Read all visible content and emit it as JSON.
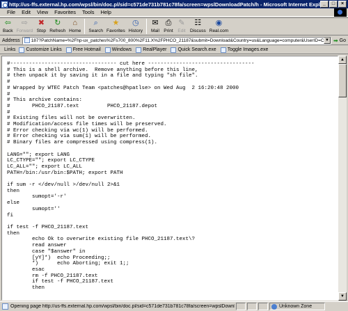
{
  "window": {
    "title": "http://us-ffs.external.hp.com/wpsl/bin/doc.pl/sid=c571de731b781c78fa/screen=wpslDownloadPatch/h - Microsoft Internet Explorer"
  },
  "menu": [
    "File",
    "Edit",
    "View",
    "Favorites",
    "Tools",
    "Help"
  ],
  "toolbar": {
    "buttons": [
      {
        "label": "Back",
        "icon": "back-arrow-icon",
        "glyph": "⇦"
      },
      {
        "label": "Forward",
        "icon": "forward-arrow-icon",
        "glyph": "⇨"
      },
      {
        "label": "Stop",
        "icon": "stop-icon",
        "glyph": "✖"
      },
      {
        "label": "Refresh",
        "icon": "refresh-icon",
        "glyph": "↻"
      },
      {
        "label": "Home",
        "icon": "home-icon",
        "glyph": "⌂"
      },
      {
        "label": "Search",
        "icon": "search-icon",
        "glyph": "⌕"
      },
      {
        "label": "Favorites",
        "icon": "favorites-icon",
        "glyph": "★"
      },
      {
        "label": "History",
        "icon": "history-icon",
        "glyph": "◷"
      },
      {
        "label": "Mail",
        "icon": "mail-icon",
        "glyph": "✉"
      },
      {
        "label": "Print",
        "icon": "print-icon",
        "glyph": "⎙"
      },
      {
        "label": "Edit",
        "icon": "edit-icon",
        "glyph": "✎"
      },
      {
        "label": "Discuss",
        "icon": "discuss-icon",
        "glyph": "☷"
      },
      {
        "label": "Real.com",
        "icon": "realcom-icon",
        "glyph": "◉"
      }
    ]
  },
  "address": {
    "label": "Address",
    "value": "187?PatchName=%2Fhp-ux_patches%2Fs700_800%2F11.X%2FPHCO_21187&submit=Download&Country=us&Language=computer&UserID=CA472732",
    "go_label": "Go"
  },
  "links": {
    "label": "Links",
    "items": [
      "Customize Links",
      "Free Hotmail",
      "Windows",
      "RealPlayer",
      "Quick Search.exe",
      "Toggle Images.exe"
    ]
  },
  "document": {
    "text": "#---------------------------------- cut here ----------------------------------\n# This is a shell archive.  Remove anything before this line,\n# then unpack it by saving it in a file and typing \"sh file\".\n#\n# Wrapped by WTEC Patch Team <patches@hpatlse> on Wed Aug  2 16:20:48 2000\n#\n# This archive contains:\n#       PHCO_21187.text         PHCO_21187.depot\n#\n# Existing files will not be overwritten.\n# Modification/access file times will be preserved.\n# Error checking via wc(1) will be performed.\n# Error checking via sum(1) will be performed.\n# Binary files are compressed using compress(1).\n\nLANG=\"\"; export LANG\nLC_CTYPE=\"\"; export LC_CTYPE\nLC_ALL=\"\"; export LC_ALL\nPATH=/bin:/usr/bin:$PATH; export PATH\n\nif sum -r </dev/null >/dev/null 2>&1\nthen\n        sumopt='-r'\nelse\n        sumopt=''\nfi\n\nif test -f PHCO_21187.text\nthen\n        echo Ok to overwrite existing file PHCO_21187.text\\?\n        read answer\n        case \"$answer\" in\n        [yY]*)  echo Proceeding;;\n        *)      echo Aborting; exit 1;;\n        esac\n        rm -f PHCO_21187.text\n        if test -f PHCO_21187.text\n        then"
  },
  "status": {
    "text": "Opening page http://us-ffs.external.hp.com/wpsl/bin/doc.pl/sid=c571de731b781c78fa/screen=wpslDownloadPatch",
    "zone": "Unknown Zone"
  }
}
